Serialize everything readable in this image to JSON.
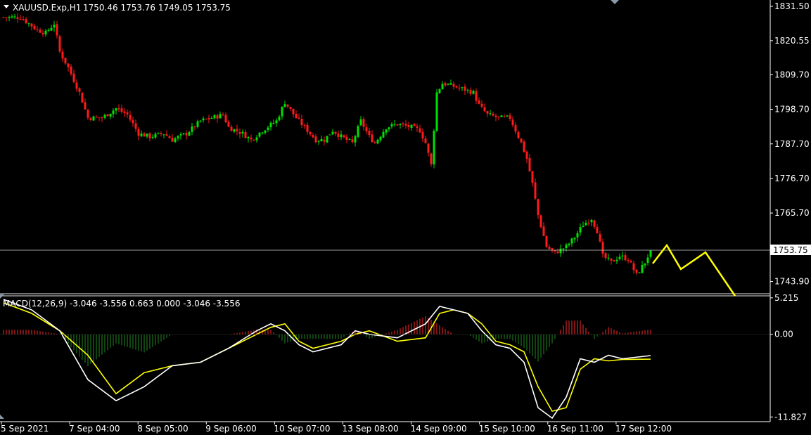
{
  "main": {
    "symbol": "XAUUSD.Exp,H1",
    "ohlc": "1750.46 1753.76 1749.05 1753.75",
    "price_label": "1753.75"
  },
  "macd": {
    "header": "MACD(12,26,9) -3.046 -3.556 0.663 0.000 -3.046 -3.556"
  },
  "colors": {
    "background": "#000000",
    "bull": "#00e000",
    "bear": "#ff1a1a",
    "macd_line": "#ffffff",
    "signal_line": "#ffff00",
    "arrows": "#ffff00",
    "axis": "#ffffff",
    "hist_pos": "#ff2a2a",
    "hist_neg": "#1f8a1f"
  },
  "chart_data": [
    {
      "type": "candlestick",
      "title": "XAUUSD.Exp,H1",
      "y_ticks": [
        "1831.50",
        "1820.55",
        "1809.70",
        "1798.70",
        "1787.70",
        "1776.70",
        "1765.70",
        "1743.90"
      ],
      "ylim": [
        1740.0,
        1833.5
      ],
      "x_ticks": [
        "5 Sep 2021",
        "7 Sep 04:00",
        "8 Sep 05:00",
        "9 Sep 06:00",
        "10 Sep 07:00",
        "13 Sep 08:00",
        "14 Sep 09:00",
        "15 Sep 10:00",
        "16 Sep 11:00",
        "17 Sep 12:00"
      ],
      "current_price": 1753.75,
      "close_path": [
        [
          0,
          1828
        ],
        [
          6,
          1828
        ],
        [
          12,
          1824
        ],
        [
          15,
          1823
        ],
        [
          18,
          1826
        ],
        [
          20,
          1817
        ],
        [
          23,
          1812
        ],
        [
          27,
          1804
        ],
        [
          30,
          1796
        ],
        [
          35,
          1796
        ],
        [
          40,
          1799
        ],
        [
          44,
          1797
        ],
        [
          48,
          1791
        ],
        [
          52,
          1790
        ],
        [
          57,
          1791
        ],
        [
          60,
          1789
        ],
        [
          65,
          1791
        ],
        [
          70,
          1795
        ],
        [
          74,
          1796
        ],
        [
          78,
          1797
        ],
        [
          80,
          1793
        ],
        [
          85,
          1791
        ],
        [
          88,
          1789
        ],
        [
          92,
          1792
        ],
        [
          97,
          1795
        ],
        [
          100,
          1801
        ],
        [
          104,
          1796
        ],
        [
          108,
          1792
        ],
        [
          111,
          1789
        ],
        [
          114,
          1789
        ],
        [
          117,
          1792
        ],
        [
          120,
          1790
        ],
        [
          124,
          1788
        ],
        [
          127,
          1795
        ],
        [
          130,
          1790
        ],
        [
          132,
          1788
        ],
        [
          136,
          1793
        ],
        [
          140,
          1794
        ],
        [
          145,
          1793
        ],
        [
          148,
          1792
        ],
        [
          150,
          1788
        ],
        [
          152,
          1781
        ],
        [
          154,
          1804
        ],
        [
          156,
          1807
        ],
        [
          160,
          1806
        ],
        [
          164,
          1805
        ],
        [
          167,
          1804
        ],
        [
          169,
          1800
        ],
        [
          172,
          1797
        ],
        [
          176,
          1796
        ],
        [
          180,
          1796
        ],
        [
          182,
          1792
        ],
        [
          184,
          1788
        ],
        [
          186,
          1783
        ],
        [
          188,
          1775
        ],
        [
          190,
          1765
        ],
        [
          193,
          1755
        ],
        [
          196,
          1753
        ],
        [
          200,
          1755
        ],
        [
          203,
          1758
        ],
        [
          206,
          1762
        ],
        [
          209,
          1764
        ],
        [
          211,
          1760
        ],
        [
          213,
          1752
        ],
        [
          216,
          1750
        ],
        [
          219,
          1752
        ],
        [
          222,
          1751
        ],
        [
          225,
          1746
        ],
        [
          228,
          1750
        ],
        [
          230,
          1753.75
        ]
      ]
    },
    {
      "type": "line",
      "title": "MACD(12,26,9)",
      "y_ticks": [
        "5.215",
        "0.00",
        "-11.827"
      ],
      "ylim": [
        -12.5,
        5.5
      ],
      "series": [
        {
          "key": "macd",
          "values": [
            [
              0,
              5.0
            ],
            [
              10,
              3.5
            ],
            [
              20,
              0.5
            ],
            [
              30,
              -6.5
            ],
            [
              40,
              -9.5
            ],
            [
              50,
              -7.5
            ],
            [
              60,
              -4.5
            ],
            [
              70,
              -4.0
            ],
            [
              80,
              -2.0
            ],
            [
              90,
              0.5
            ],
            [
              95,
              1.5
            ],
            [
              100,
              0.5
            ],
            [
              105,
              -1.5
            ],
            [
              110,
              -2.5
            ],
            [
              120,
              -1.5
            ],
            [
              125,
              0.5
            ],
            [
              130,
              0.0
            ],
            [
              140,
              -0.5
            ],
            [
              150,
              1.5
            ],
            [
              155,
              4.0
            ],
            [
              160,
              3.5
            ],
            [
              165,
              3.0
            ],
            [
              170,
              0.5
            ],
            [
              175,
              -1.5
            ],
            [
              180,
              -2.0
            ],
            [
              185,
              -4.0
            ],
            [
              190,
              -10.5
            ],
            [
              195,
              -12.0
            ],
            [
              200,
              -9.0
            ],
            [
              205,
              -3.5
            ],
            [
              210,
              -4.0
            ],
            [
              215,
              -3.0
            ],
            [
              220,
              -3.5
            ],
            [
              230,
              -3.05
            ]
          ]
        },
        {
          "key": "signal",
          "values": [
            [
              0,
              4.5
            ],
            [
              10,
              3.0
            ],
            [
              20,
              0.5
            ],
            [
              30,
              -3.0
            ],
            [
              40,
              -8.5
            ],
            [
              50,
              -5.5
            ],
            [
              60,
              -4.5
            ],
            [
              70,
              -4.0
            ],
            [
              80,
              -2.0
            ],
            [
              90,
              0.0
            ],
            [
              95,
              1.0
            ],
            [
              100,
              1.5
            ],
            [
              105,
              -1.0
            ],
            [
              110,
              -2.0
            ],
            [
              120,
              -1.0
            ],
            [
              125,
              0.0
            ],
            [
              130,
              0.5
            ],
            [
              140,
              -1.0
            ],
            [
              150,
              -0.5
            ],
            [
              155,
              3.0
            ],
            [
              160,
              3.5
            ],
            [
              165,
              3.0
            ],
            [
              170,
              1.5
            ],
            [
              175,
              -1.0
            ],
            [
              180,
              -1.5
            ],
            [
              185,
              -2.5
            ],
            [
              190,
              -7.5
            ],
            [
              195,
              -11.0
            ],
            [
              200,
              -10.5
            ],
            [
              205,
              -5.0
            ],
            [
              210,
              -3.5
            ],
            [
              215,
              -3.8
            ],
            [
              220,
              -3.6
            ],
            [
              230,
              -3.56
            ]
          ]
        }
      ]
    }
  ]
}
